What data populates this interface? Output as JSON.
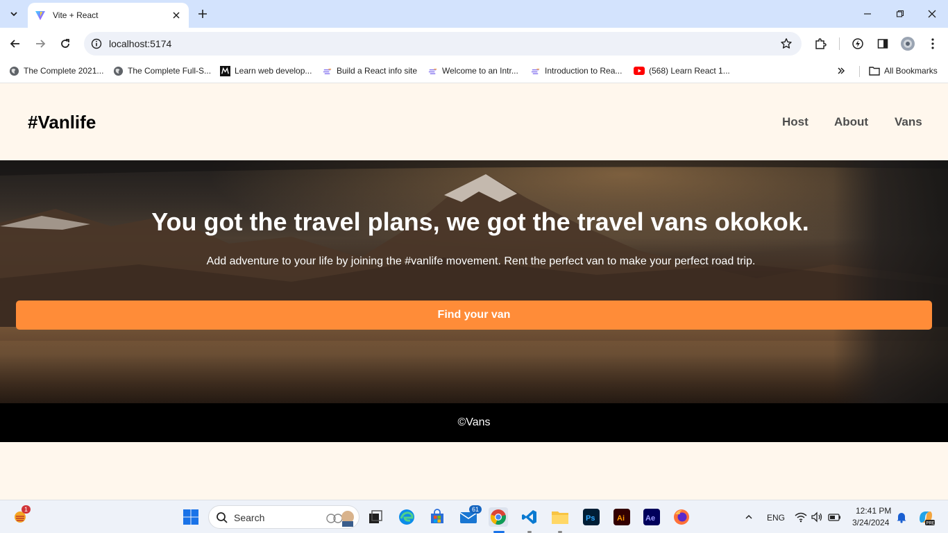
{
  "browser": {
    "tab_title": "Vite + React",
    "url": "localhost:5174",
    "bookmarks": [
      {
        "label": "The Complete 2021...",
        "icon": "globe-icon"
      },
      {
        "label": "The Complete Full-S...",
        "icon": "globe-icon"
      },
      {
        "label": "Learn web develop...",
        "icon": "m-logo-icon"
      },
      {
        "label": "Build a React info site",
        "icon": "scrimba-icon"
      },
      {
        "label": "Welcome to an Intr...",
        "icon": "scrimba-icon"
      },
      {
        "label": "Introduction to Rea...",
        "icon": "scrimba-icon"
      },
      {
        "label": "(568) Learn React 1...",
        "icon": "youtube-icon"
      }
    ],
    "all_bookmarks_label": "All Bookmarks"
  },
  "site": {
    "logo": "#Vanlife",
    "nav": [
      "Host",
      "About",
      "Vans"
    ],
    "hero": {
      "title": "You got the travel plans, we got the travel vans okokok.",
      "subtitle": "Add adventure to your life by joining the #vanlife movement. Rent the perfect van to make your perfect road trip.",
      "button": "Find your van"
    },
    "footer": "©Vans"
  },
  "taskbar": {
    "search_label": "Search",
    "weather_badge": "1",
    "mail_badge": "61",
    "language": "ENG",
    "time": "12:41 PM",
    "date": "3/24/2024"
  },
  "colors": {
    "page_bg": "#fff7ed",
    "accent": "#ff8c38",
    "footer_bg": "#000000"
  }
}
